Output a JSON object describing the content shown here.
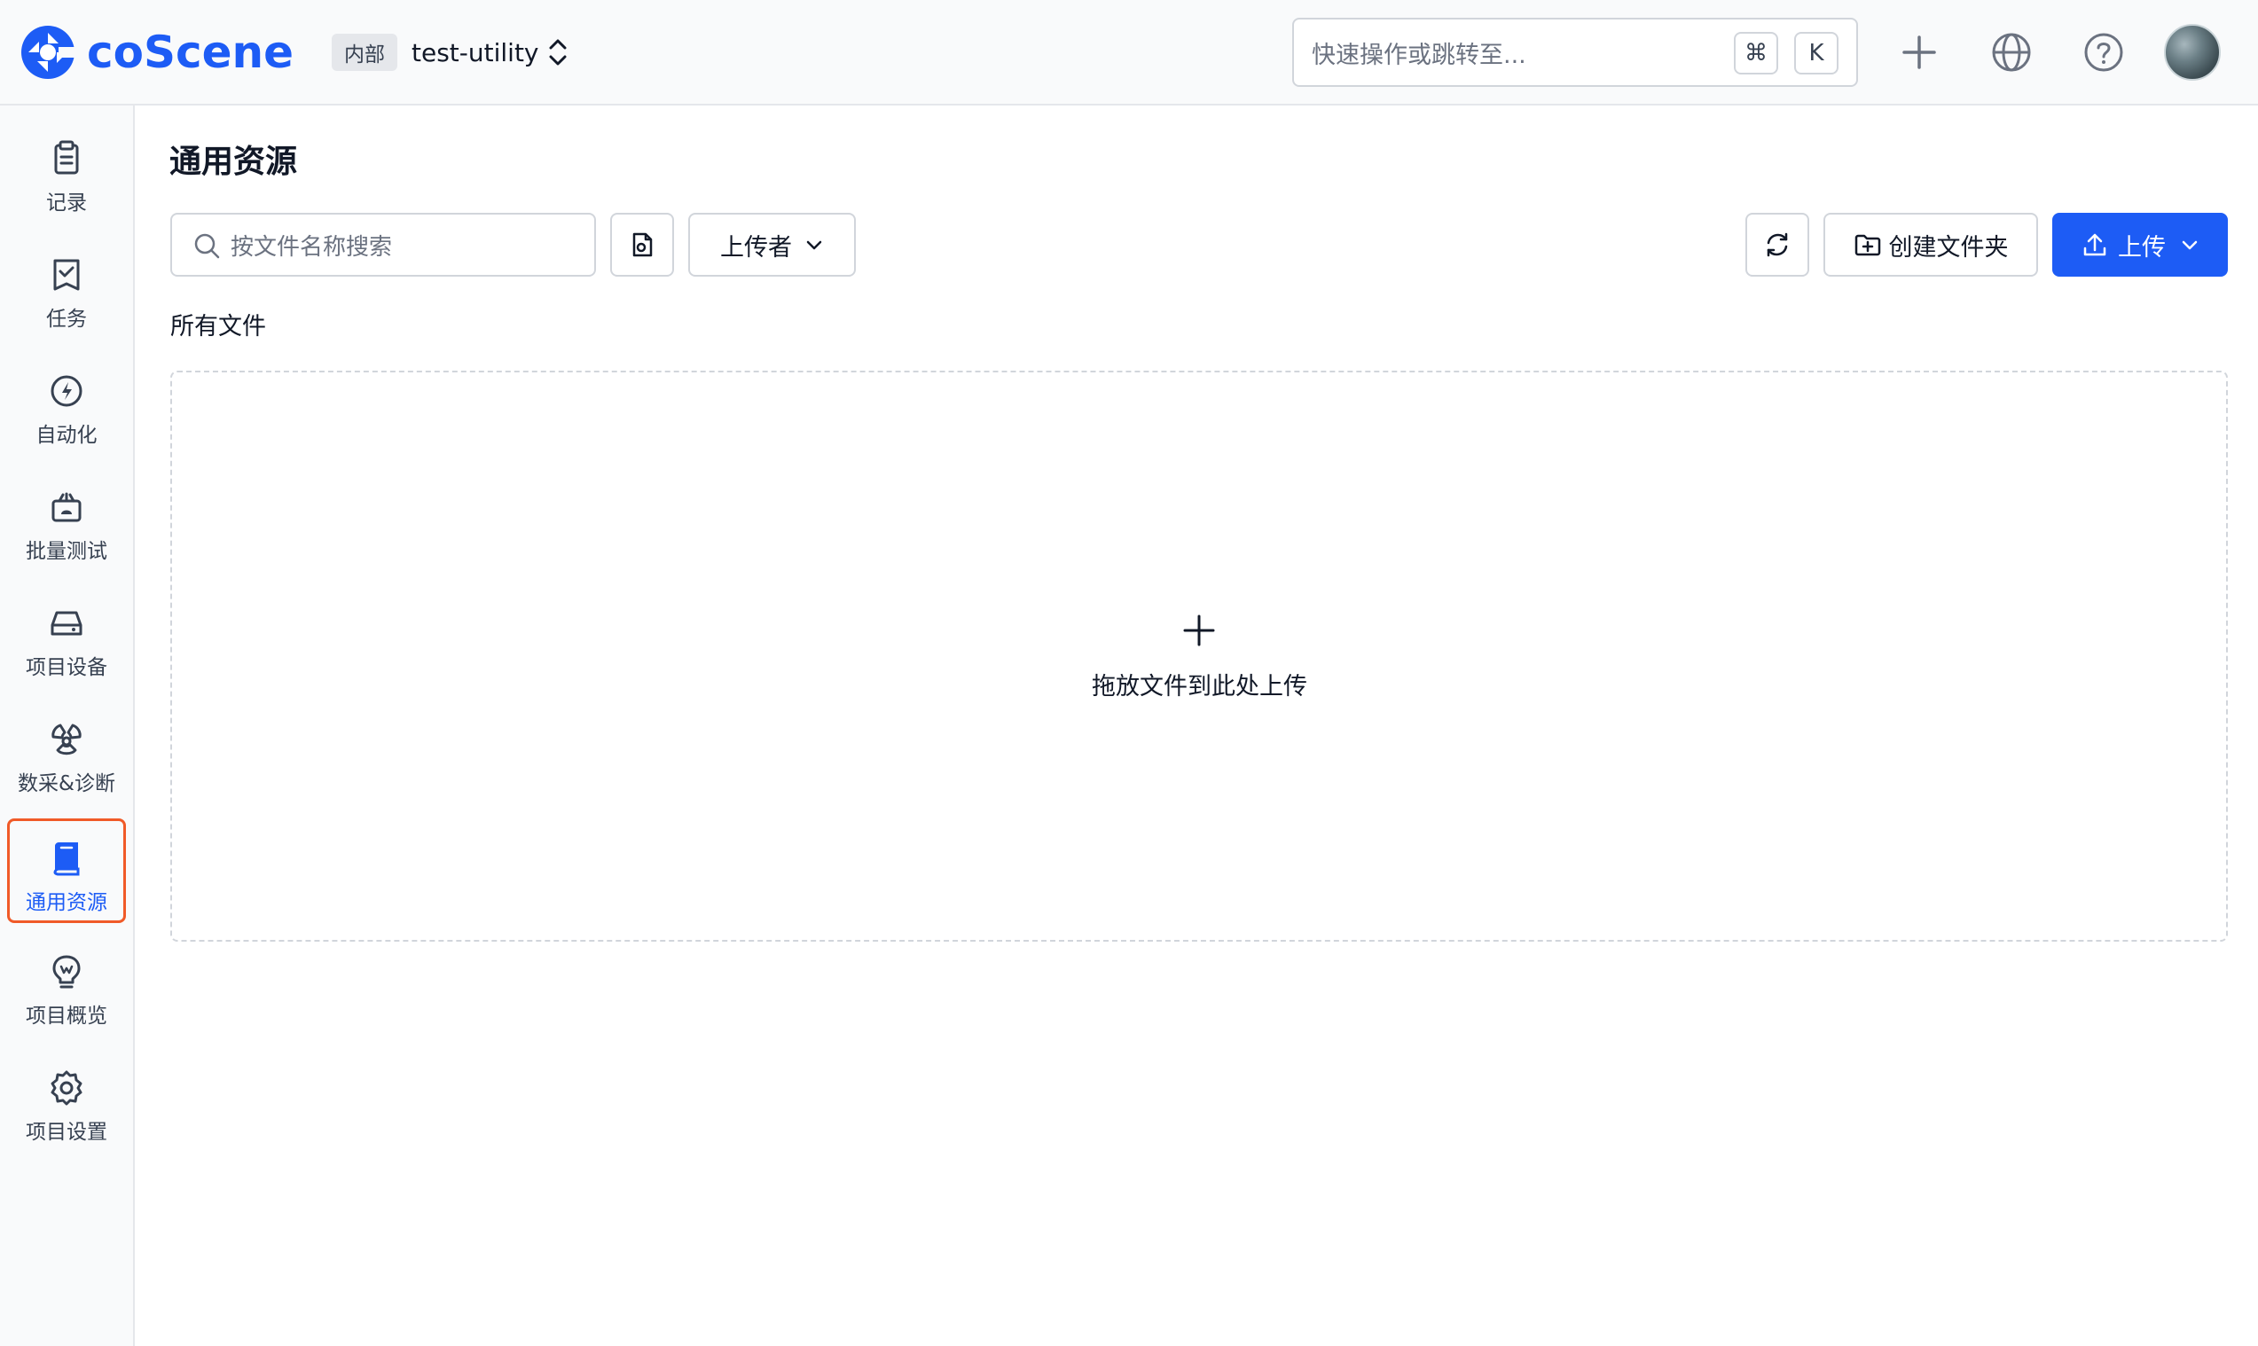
{
  "header": {
    "logo_text": "coScene",
    "project_badge": "内部",
    "project_name": "test-utility",
    "search_placeholder": "快速操作或跳转至...",
    "shortcut_keys": [
      "⌘",
      "K"
    ]
  },
  "sidebar": {
    "items": [
      {
        "label": "记录",
        "icon": "clipboard-icon"
      },
      {
        "label": "任务",
        "icon": "task-check-icon"
      },
      {
        "label": "自动化",
        "icon": "automation-icon"
      },
      {
        "label": "批量测试",
        "icon": "batch-test-icon"
      },
      {
        "label": "项目设备",
        "icon": "device-icon"
      },
      {
        "label": "数采&诊断",
        "icon": "diagnosis-icon"
      },
      {
        "label": "通用资源",
        "icon": "book-icon",
        "active": true
      },
      {
        "label": "项目概览",
        "icon": "lightbulb-icon"
      },
      {
        "label": "项目设置",
        "icon": "gear-icon"
      }
    ]
  },
  "main": {
    "title": "通用资源",
    "search_placeholder": "按文件名称搜索",
    "uploader_filter": "上传者",
    "create_folder": "创建文件夹",
    "upload": "上传",
    "breadcrumb": "所有文件",
    "dropzone_text": "拖放文件到此处上传"
  },
  "colors": {
    "brand": "#1d5cf5",
    "active_outline": "#f05a28"
  }
}
